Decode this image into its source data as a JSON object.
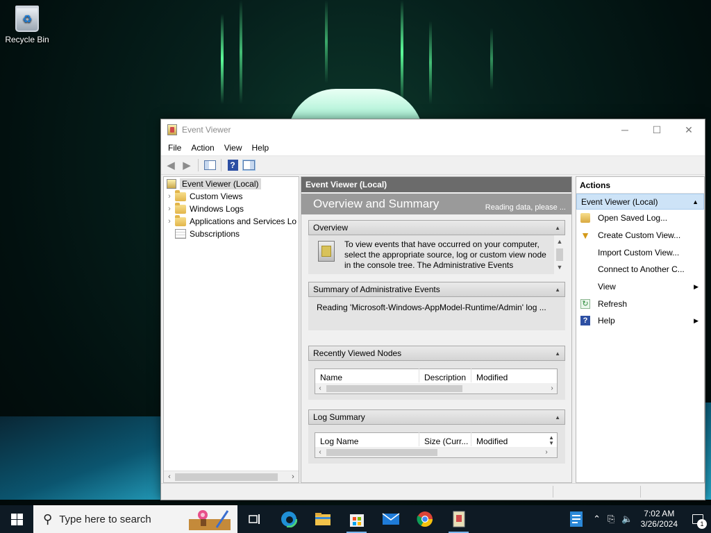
{
  "desktop": {
    "icons": [
      {
        "label": "Recycle Bin",
        "icon": "recycle-bin-icon"
      }
    ]
  },
  "window": {
    "title": "Event Viewer",
    "controls": {
      "minimize": "─",
      "maximize": "☐",
      "close": "✕"
    },
    "menu": [
      "File",
      "Action",
      "View",
      "Help"
    ],
    "toolbar": [
      {
        "icon": "back-arrow-icon",
        "enabled": false
      },
      {
        "icon": "forward-arrow-icon",
        "enabled": false
      },
      {
        "icon": "show-hide-console-tree-icon"
      },
      {
        "icon": "help-icon"
      },
      {
        "icon": "show-hide-action-pane-icon"
      }
    ]
  },
  "tree": {
    "items": [
      {
        "label": "Event Viewer (Local)",
        "selected": true,
        "level": 0
      },
      {
        "label": "Custom Views",
        "level": 1,
        "expandable": true
      },
      {
        "label": "Windows Logs",
        "level": 1,
        "expandable": true
      },
      {
        "label": "Applications and Services Lo",
        "level": 1,
        "expandable": true
      },
      {
        "label": "Subscriptions",
        "level": 1,
        "expandable": false
      }
    ]
  },
  "center": {
    "header": "Event Viewer (Local)",
    "banner_title": "Overview and Summary",
    "banner_status": "Reading data, please ...",
    "overview": {
      "heading": "Overview",
      "text": "To view events that have occurred on your computer, select the appropriate source, log or custom view node in the console tree. The Administrative Events"
    },
    "summary": {
      "heading": "Summary of Administrative Events",
      "text": "Reading 'Microsoft-Windows-AppModel-Runtime/Admin' log ..."
    },
    "recent_nodes": {
      "heading": "Recently Viewed Nodes",
      "columns": [
        "Name",
        "Description",
        "Modified"
      ]
    },
    "log_summary": {
      "heading": "Log Summary",
      "columns": [
        "Log Name",
        "Size (Curr...",
        "Modified"
      ]
    }
  },
  "actions": {
    "title": "Actions",
    "group": "Event Viewer (Local)",
    "items": [
      {
        "label": "Open Saved Log...",
        "icon": "open-folder-icon"
      },
      {
        "label": "Create Custom View...",
        "icon": "filter-icon"
      },
      {
        "label": "Import Custom View...",
        "icon": ""
      },
      {
        "label": "Connect to Another C...",
        "icon": ""
      },
      {
        "label": "View",
        "icon": "",
        "submenu": true
      },
      {
        "label": "Refresh",
        "icon": "refresh-icon"
      },
      {
        "label": "Help",
        "icon": "help-icon",
        "submenu": true
      }
    ]
  },
  "taskbar": {
    "search_placeholder": "Type here to search",
    "apps": [
      "task-view-icon",
      "edge-icon",
      "file-explorer-icon",
      "store-icon",
      "mail-icon",
      "chrome-icon",
      "event-viewer-icon"
    ],
    "pinned_right": "notepad-icon",
    "time": "7:02 AM",
    "date": "3/26/2024",
    "notification_count": "1"
  }
}
